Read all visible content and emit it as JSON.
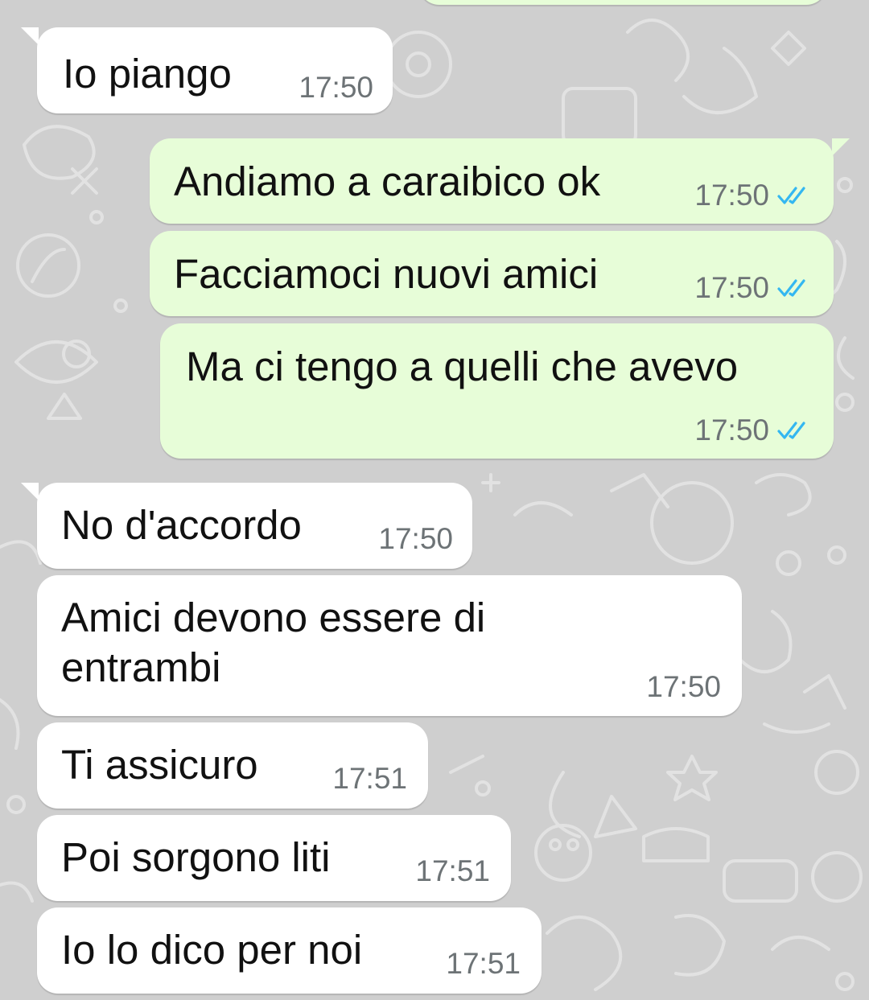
{
  "chat": {
    "messages": [
      {
        "direction": "in",
        "text": "Io piango",
        "time": "17:50"
      },
      {
        "direction": "out",
        "text": "Andiamo a caraibico ok",
        "time": "17:50",
        "status": "read"
      },
      {
        "direction": "out",
        "text": "Facciamoci nuovi amici",
        "time": "17:50",
        "status": "read"
      },
      {
        "direction": "out",
        "text": "Ma ci tengo a quelli che avevo",
        "time": "17:50",
        "status": "read"
      },
      {
        "direction": "in",
        "text": "No d'accordo",
        "time": "17:50"
      },
      {
        "direction": "in",
        "text": "Amici devono essere di entrambi",
        "time": "17:50"
      },
      {
        "direction": "in",
        "text": "Ti assicuro",
        "time": "17:51"
      },
      {
        "direction": "in",
        "text": "Poi sorgono liti",
        "time": "17:51"
      },
      {
        "direction": "in",
        "text": "Io lo dico per noi",
        "time": "17:51"
      }
    ]
  },
  "icons": {
    "read_receipt": "double-check-icon",
    "wallpaper": "doodle-pattern"
  },
  "colors": {
    "background": "#cfcfcf",
    "incoming_bubble": "#ffffff",
    "outgoing_bubble": "#e7fdd8",
    "read_ticks": "#34b7f1",
    "timestamp": "#6d7376"
  }
}
